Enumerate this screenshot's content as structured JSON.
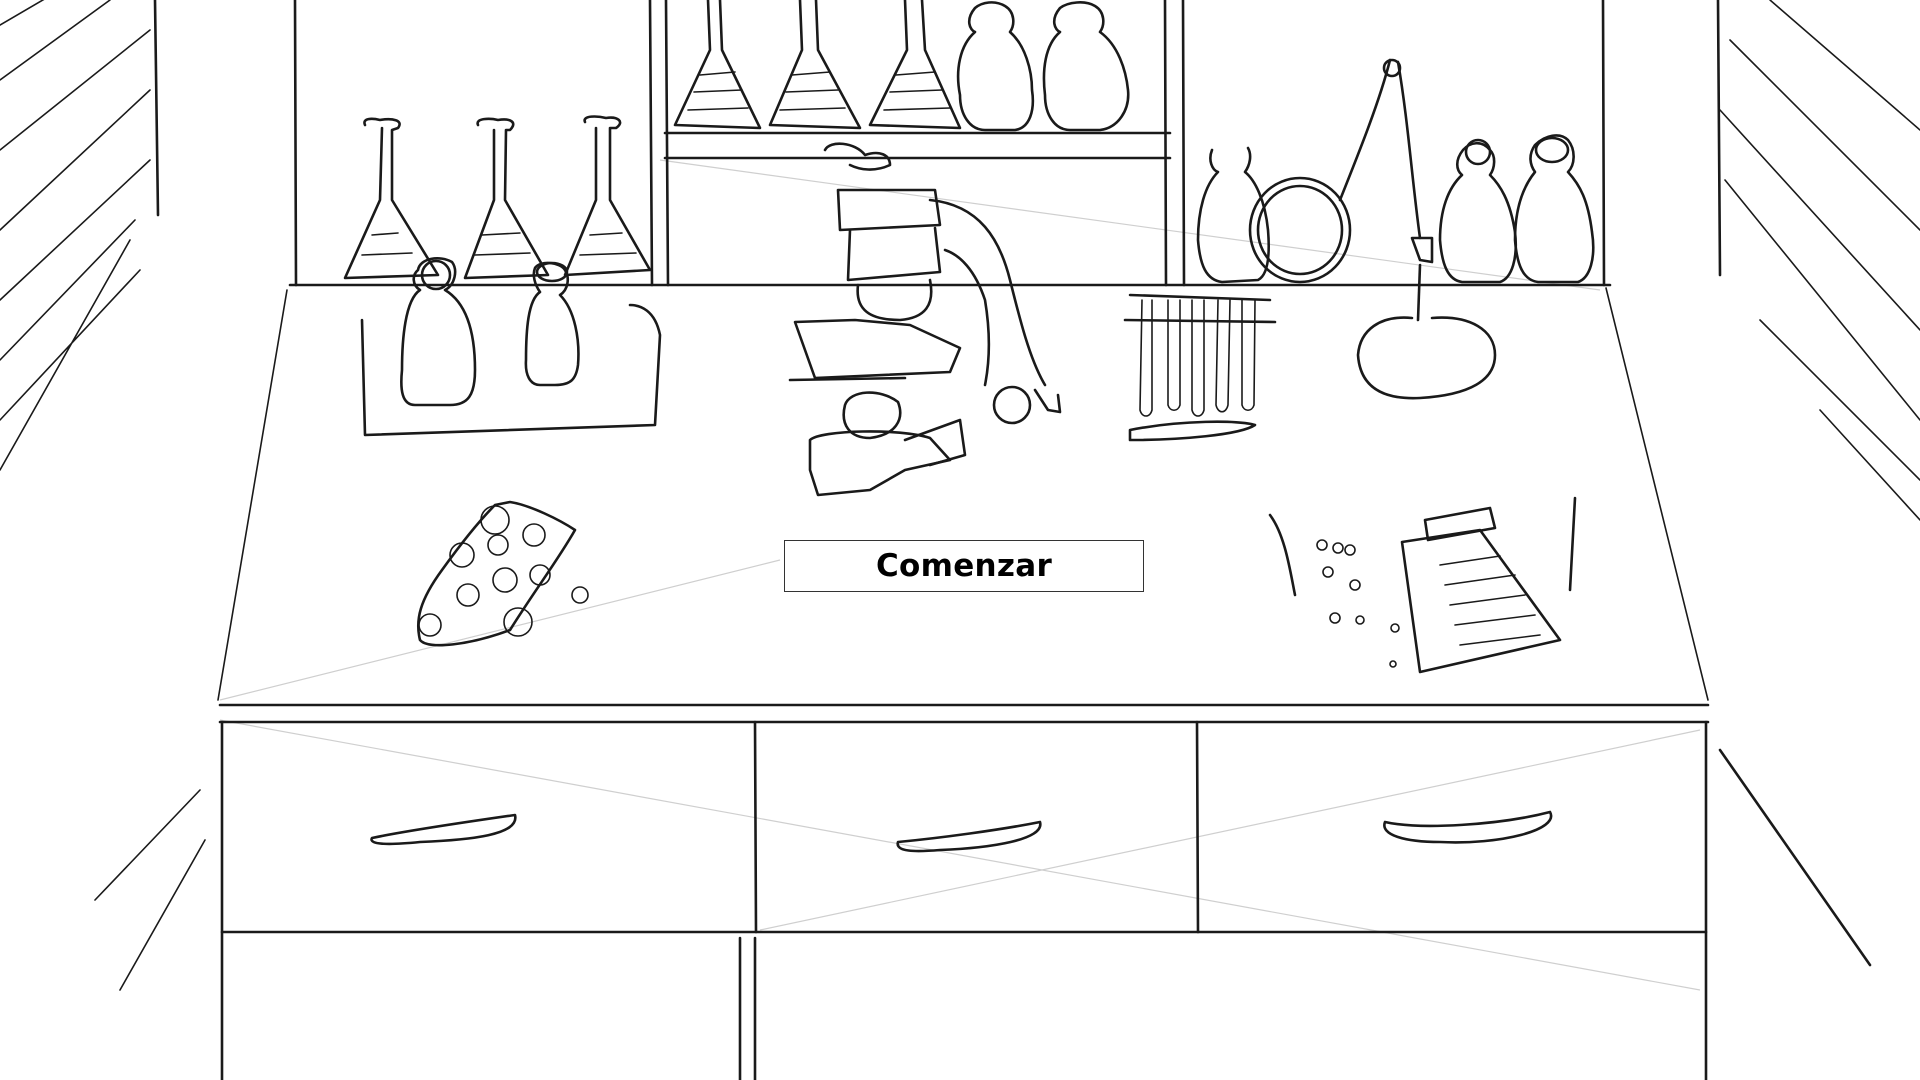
{
  "start_button": {
    "label": "Comenzar"
  },
  "colors": {
    "background": "#ffffff",
    "ink": "#1a1a1a",
    "button_border": "#333333"
  }
}
